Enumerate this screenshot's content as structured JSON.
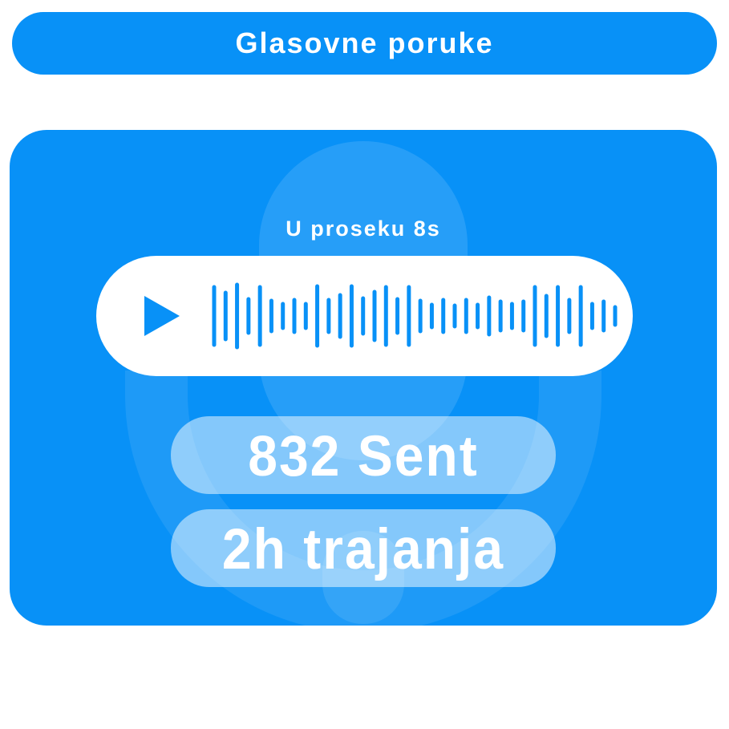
{
  "header": {
    "title": "Glasovne poruke"
  },
  "card": {
    "average_label": "U proseku 8s",
    "player": {
      "play_icon": "play-icon",
      "waveform_levels": [
        0.72,
        0.58,
        0.78,
        0.42,
        0.72,
        0.38,
        0.3,
        0.4,
        0.3,
        0.74,
        0.4,
        0.52,
        0.74,
        0.44,
        0.6,
        0.72,
        0.42,
        0.72,
        0.38,
        0.28,
        0.4,
        0.26,
        0.4,
        0.28,
        0.46,
        0.36,
        0.3,
        0.36,
        0.72,
        0.5,
        0.72,
        0.4,
        0.72,
        0.3,
        0.36,
        0.22
      ]
    },
    "sent_stat": "832 Sent",
    "duration_stat": "2h trajanja"
  },
  "colors": {
    "brand_blue": "#0891f7",
    "white": "#ffffff"
  }
}
